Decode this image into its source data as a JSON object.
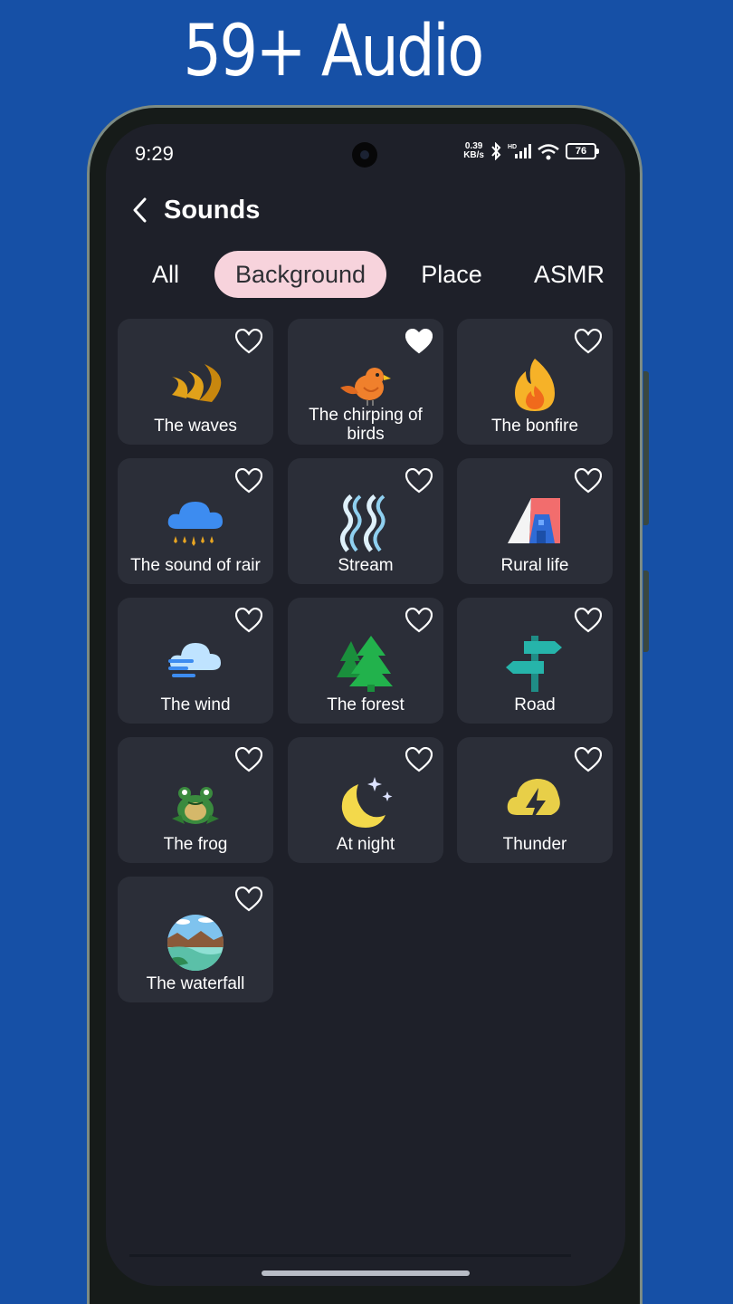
{
  "promo": {
    "headline": "59+ Audio"
  },
  "status_bar": {
    "time": "9:29",
    "net_speed_value": "0.39",
    "net_speed_unit": "KB/s",
    "signal_tag": "HD",
    "battery": "76"
  },
  "header": {
    "title": "Sounds"
  },
  "tabs": [
    {
      "label": "All"
    },
    {
      "label": "Background",
      "selected": true
    },
    {
      "label": "Place"
    },
    {
      "label": "ASMR"
    }
  ],
  "sounds": [
    {
      "label": "The waves",
      "icon": "waves-icon",
      "favorite": false
    },
    {
      "label": "The chirping of birds",
      "icon": "bird-icon",
      "favorite": true
    },
    {
      "label": "The bonfire",
      "icon": "fire-icon",
      "favorite": false
    },
    {
      "label": "The sound of rair",
      "icon": "rain-cloud-icon",
      "favorite": false
    },
    {
      "label": "Stream",
      "icon": "stream-icon",
      "favorite": false
    },
    {
      "label": "Rural life",
      "icon": "house-icon",
      "favorite": false
    },
    {
      "label": "The wind",
      "icon": "wind-icon",
      "favorite": false
    },
    {
      "label": "The forest",
      "icon": "tree-icon",
      "favorite": false
    },
    {
      "label": "Road",
      "icon": "signpost-icon",
      "favorite": false
    },
    {
      "label": "The frog",
      "icon": "frog-icon",
      "favorite": false
    },
    {
      "label": "At night",
      "icon": "moon-icon",
      "favorite": false
    },
    {
      "label": "Thunder",
      "icon": "thunder-icon",
      "favorite": false
    },
    {
      "label": "The waterfall",
      "icon": "waterfall-icon",
      "favorite": false
    }
  ],
  "colors": {
    "background": "#1650a6",
    "screen": "#1e2029",
    "card": "#2b2e38",
    "active_tab": "#f7d3dc"
  }
}
